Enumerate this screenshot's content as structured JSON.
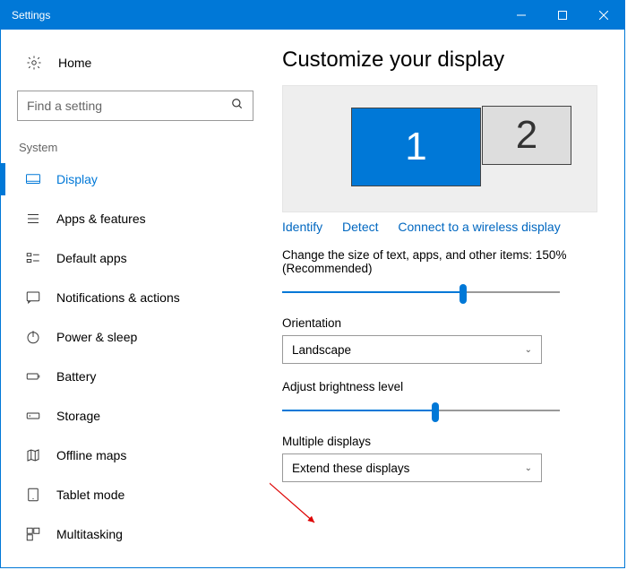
{
  "window": {
    "title": "Settings"
  },
  "sidebar": {
    "home": "Home",
    "search_placeholder": "Find a setting",
    "group": "System",
    "items": [
      {
        "label": "Display"
      },
      {
        "label": "Apps & features"
      },
      {
        "label": "Default apps"
      },
      {
        "label": "Notifications & actions"
      },
      {
        "label": "Power & sleep"
      },
      {
        "label": "Battery"
      },
      {
        "label": "Storage"
      },
      {
        "label": "Offline maps"
      },
      {
        "label": "Tablet mode"
      },
      {
        "label": "Multitasking"
      }
    ]
  },
  "content": {
    "heading": "Customize your display",
    "monitor1": "1",
    "monitor2": "2",
    "links": {
      "identify": "Identify",
      "detect": "Detect",
      "wireless": "Connect to a wireless display"
    },
    "scale_text": "Change the size of text, apps, and other items: 150% (Recommended)",
    "orientation_label": "Orientation",
    "orientation_value": "Landscape",
    "brightness_label": "Adjust brightness level",
    "multi_label": "Multiple displays",
    "multi_value": "Extend these displays"
  }
}
